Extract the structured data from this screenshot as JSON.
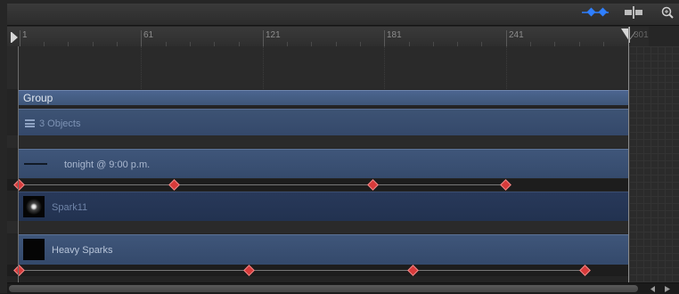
{
  "ruler": {
    "labels": [
      "1",
      "61",
      "121",
      "181",
      "241",
      "301"
    ]
  },
  "tracks": {
    "group_label": "Group",
    "objects_label": "3 Objects",
    "text_layer_label": "tonight @ 9:00 p.m.",
    "spark_label": "Spark11",
    "heavy_sparks_label": "Heavy Sparks"
  },
  "icons": {
    "keyframe_toggle": "keyframe-toggle-icon",
    "snap": "snap-icon",
    "zoom": "zoom-icon",
    "play_range_start": "play-range-start-icon",
    "play_range_end": "play-range-end-icon",
    "layer_stack": "layer-stack-icon",
    "text_layer": "text-layer-icon",
    "scroll_left": "scroll-left-icon",
    "scroll_right": "scroll-right-icon"
  },
  "colors": {
    "track_blue": "#3e5678",
    "keyframe_red": "#d83a3a",
    "accent_blue": "#2f7fff"
  }
}
